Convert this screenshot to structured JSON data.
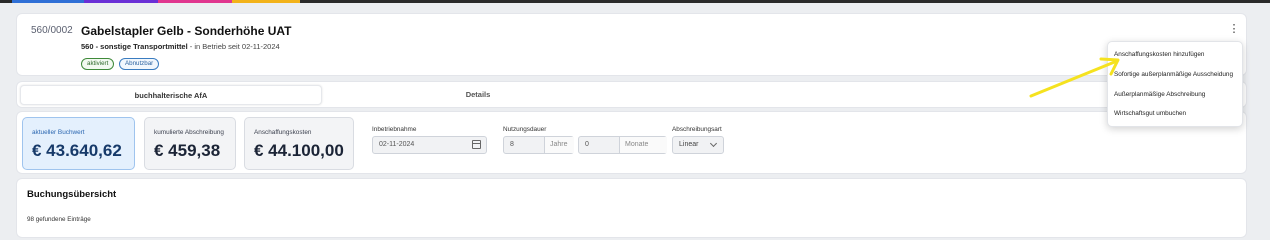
{
  "topstrip": {
    "colors": [
      "#2f6fd6",
      "#6a2fd6",
      "#e0368f",
      "#f2b21a"
    ]
  },
  "header": {
    "asset_number": "560/0002",
    "title": "Gabelstapler Gelb - Sonderhöhe UAT",
    "category": "560 - sonstige Transportmittel",
    "status_text": " - in Betrieb seit 02-11-2024",
    "badges": [
      "aktiviert",
      "Abnutzbar"
    ],
    "menu_icon": "kebab-vertical-icon"
  },
  "tabs": [
    {
      "label": "buchhalterische AfA",
      "active": true
    },
    {
      "label": "Details",
      "active": false
    }
  ],
  "values": {
    "buchwert": {
      "label": "aktueller Buchwert",
      "value": "€ 43.640,62"
    },
    "kumuliert": {
      "label": "kumulierte Abschreibung",
      "value": "€ 459,38"
    },
    "anschaffung": {
      "label": "Anschaffungskosten",
      "value": "€ 44.100,00"
    }
  },
  "fields": {
    "inbetriebnahme": {
      "label": "Inbetriebnahme",
      "value": "02-11-2024",
      "icon": "calendar-icon"
    },
    "nutzungsdauer": {
      "label": "Nutzungsdauer",
      "years_value": "8",
      "years_unit": "Jahre",
      "months_value": "0",
      "months_unit": "Monate"
    },
    "abschreibungsart": {
      "label": "Abschreibungsart",
      "value": "Linear",
      "icon": "chevron-down-icon"
    }
  },
  "booking": {
    "title": "Buchungsübersicht",
    "count_text": "98 gefundene Einträge"
  },
  "menu": {
    "items": [
      "Anschaffungskosten hinzufügen",
      "Sofortige außerplanmäßige Ausscheidung",
      "Außerplanmäßige Abschreibung",
      "Wirtschaftsgut umbuchen"
    ]
  },
  "annotation": {
    "color": "#f5e21f",
    "icon": "arrow-annotation-icon"
  }
}
